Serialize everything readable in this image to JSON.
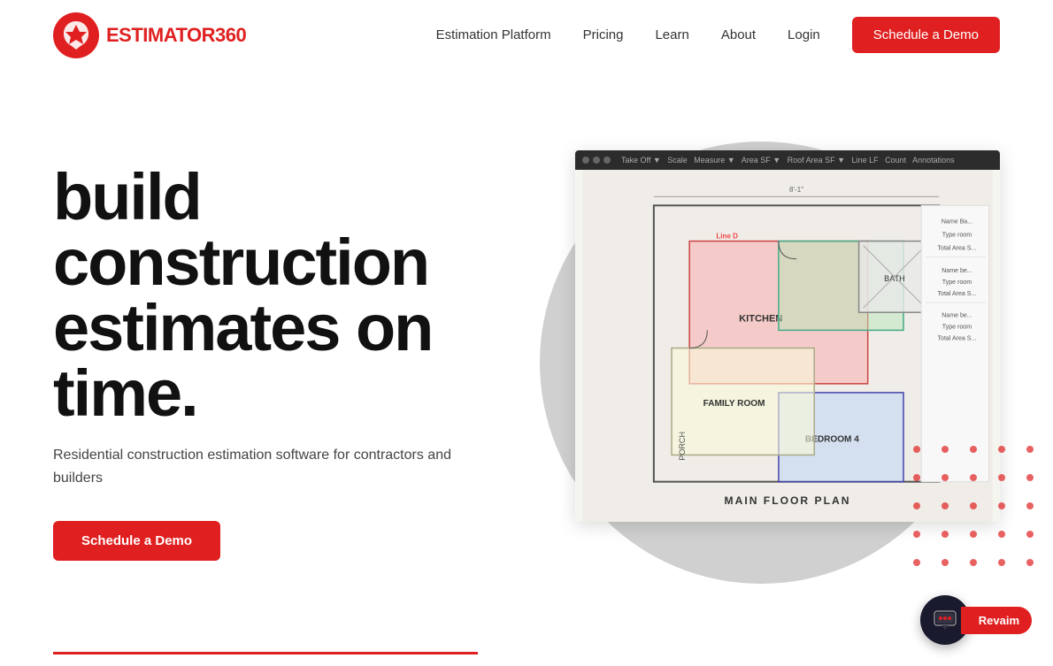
{
  "brand": {
    "name_part1": "ESTIMATOR",
    "name_part2": "360",
    "logo_alt": "Estimator360 Logo"
  },
  "nav": {
    "links": [
      {
        "id": "estimation-platform",
        "label": "Estimation Platform",
        "href": "#"
      },
      {
        "id": "pricing",
        "label": "Pricing",
        "href": "#"
      },
      {
        "id": "learn",
        "label": "Learn",
        "href": "#"
      },
      {
        "id": "about",
        "label": "About",
        "href": "#"
      },
      {
        "id": "login",
        "label": "Login",
        "href": "#"
      }
    ],
    "cta": "Schedule a Demo"
  },
  "hero": {
    "headline_line1": "build",
    "headline_line2": "construction",
    "headline_line3": "estimates on",
    "headline_line4": "time.",
    "subtext": "Residential construction estimation software for contractors and builders",
    "cta_button": "Schedule a Demo"
  },
  "chat": {
    "label": "Revaim",
    "icon": "chat-icon"
  },
  "colors": {
    "accent": "#e02020",
    "dark": "#1a1a2e",
    "text": "#111111"
  }
}
